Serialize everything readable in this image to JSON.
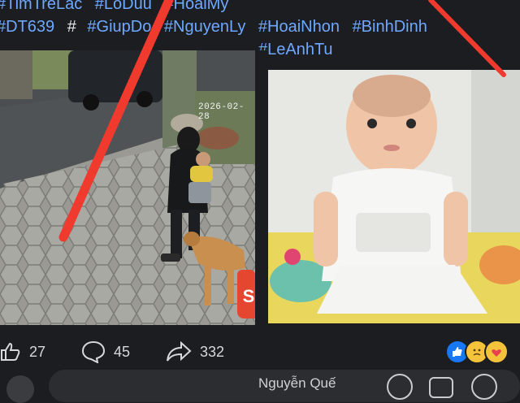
{
  "post": {
    "hashtags": {
      "line1": [
        "#TimTreLac",
        "#LoDuu",
        "#HoaiMy"
      ],
      "line2": [
        "#DT639",
        "#GiupDo",
        "#NguyenLy",
        "#HoaiNhon",
        "#BinhDinh"
      ],
      "line2_plain": "#",
      "line3": [
        "#LeAnhTu"
      ]
    },
    "left_photo": {
      "timestamp": "2026-02-28"
    },
    "sticker_text": "S"
  },
  "actions": {
    "like_count": "27",
    "comment_count": "45",
    "share_count": "332"
  },
  "comment_bar": {
    "author_partial": "Nguyễn Quế"
  },
  "colors": {
    "background": "#1b1d21",
    "hashtag": "#6fa8ff",
    "red_stroke": "#f03a2e",
    "like_blue": "#1877f2"
  }
}
